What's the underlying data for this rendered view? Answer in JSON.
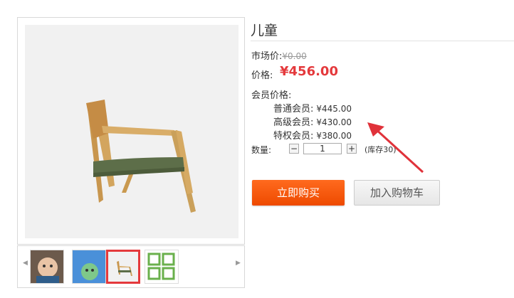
{
  "product": {
    "title": "儿童",
    "market_price_label": "市场价:",
    "market_price": "¥0.00",
    "price_label": "价格:",
    "price": "¥456.00",
    "member_price_label": "会员价格:",
    "member_prices": [
      {
        "label": "普通会员:",
        "value": "¥445.00"
      },
      {
        "label": "高级会员:",
        "value": "¥430.00"
      },
      {
        "label": "特权会员:",
        "value": "¥380.00"
      }
    ],
    "quantity_label": "数量:",
    "quantity": "1",
    "minus": "−",
    "plus": "+",
    "stock": "(库存30)"
  },
  "actions": {
    "buy_now": "立即购买",
    "add_to_cart": "加入购物车"
  },
  "gallery": {
    "thumbs": [
      "child-photo",
      "cartoon-avatar",
      "chair-photo",
      "grid-icon"
    ],
    "active_index": 2,
    "prev_icon": "arrow-left-icon",
    "next_icon": "arrow-right-icon"
  },
  "colors": {
    "accent": "#e4393c",
    "buy_button": "#ff4e00",
    "arrow": "#e0323a"
  }
}
